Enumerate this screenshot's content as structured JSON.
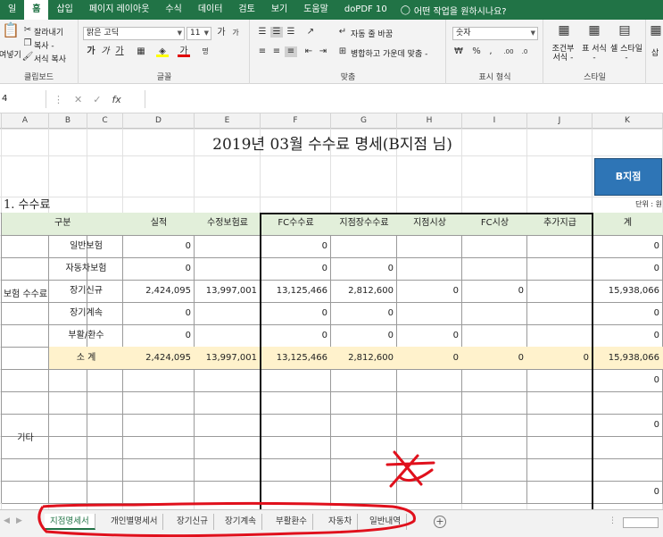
{
  "ribbon_tabs": [
    "일",
    "홈",
    "삽입",
    "페이지 레이아웃",
    "수식",
    "데이터",
    "검토",
    "보기",
    "도움말",
    "doPDF 10"
  ],
  "active_tab": "홈",
  "tell_me": "어떤 작업을 원하시나요?",
  "ribbon": {
    "cut": "잘라내기",
    "copy": "복사 -",
    "format_painter": "서식 복사",
    "paste_partial": "여넣기",
    "clipboard_label": "클립보드",
    "font_name": "맑은 고딕",
    "font_size": "11",
    "font_label": "글꼴",
    "wrap_text": "자동 줄 바꿈",
    "merge_center": "병합하고 가운데 맞춤 -",
    "align_label": "맞춤",
    "number_format": "숫자",
    "number_label": "표시 형식",
    "cond_format": "조건부 서식 -",
    "table_format": "표 서식 -",
    "cell_style": "셀 스타일 -",
    "styles_label": "스타일",
    "insert_partial": "삽"
  },
  "formula_bar": {
    "name_box": "4",
    "fx": "fx"
  },
  "columns": [
    "A",
    "B",
    "C",
    "D",
    "E",
    "F",
    "G",
    "H",
    "I",
    "J",
    "K"
  ],
  "sheet": {
    "title": "2019년 03월 수수료 명세(B지점 님)",
    "branch_badge": "B지점",
    "section": "1. 수수료",
    "unit": "단위 : 원",
    "headers": [
      "구분",
      "실적",
      "수정보험료",
      "FC수수료",
      "지점장수수료",
      "지점시상",
      "FC시상",
      "추가지급",
      "계"
    ],
    "group1_label": "보험 수수료",
    "rows": [
      {
        "label": "일반보험",
        "c": [
          "0",
          "",
          "0",
          "",
          "",
          "",
          "",
          "0"
        ]
      },
      {
        "label": "자동차보험",
        "c": [
          "0",
          "",
          "0",
          "0",
          "",
          "",
          "",
          "0"
        ]
      },
      {
        "label": "장기신규",
        "c": [
          "2,424,095",
          "13,997,001",
          "13,125,466",
          "2,812,600",
          "0",
          "0",
          "",
          "15,938,066"
        ]
      },
      {
        "label": "장기계속",
        "c": [
          "0",
          "",
          "0",
          "0",
          "",
          "",
          "",
          "0"
        ]
      },
      {
        "label": "부활/환수",
        "c": [
          "0",
          "",
          "0",
          "0",
          "0",
          "",
          "",
          "0"
        ]
      }
    ],
    "subtotal": {
      "label": "소   계",
      "c": [
        "2,424,095",
        "13,997,001",
        "13,125,466",
        "2,812,600",
        "0",
        "0",
        "0",
        "15,938,066"
      ]
    },
    "group2_label": "기타",
    "other_totals": [
      "0",
      "",
      "0",
      "",
      "",
      "0",
      "0"
    ]
  },
  "sheet_tabs": [
    "지점명세서",
    "개인별명세서",
    "장기신규",
    "장기계속",
    "부활환수",
    "자동차",
    "일반내역"
  ],
  "active_sheet": "지점명세서",
  "colors": {
    "ribbon_green": "#217346",
    "header_fill": "#e2efda",
    "subtotal_fill": "#fff2cc",
    "badge_fill": "#2e75b6",
    "annotation_red": "#e0101c"
  }
}
